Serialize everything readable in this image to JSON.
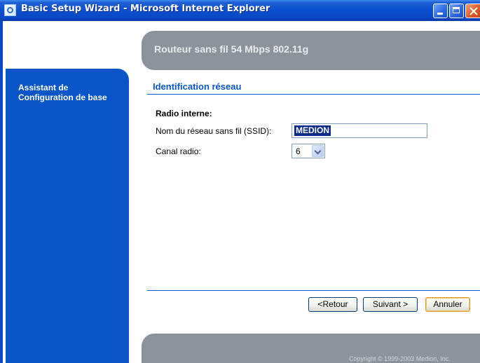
{
  "window": {
    "title": "Basic Setup Wizard - Microsoft Internet Explorer"
  },
  "header": {
    "title": "Routeur sans fil 54 Mbps 802.11g"
  },
  "sidebar": {
    "label": "Assistant de Configuration de base"
  },
  "section": {
    "title": "Identification réseau",
    "subsection": "Radio interne:"
  },
  "form": {
    "ssid_label": "Nom du réseau sans fil (SSID):",
    "ssid_value": "MEDION",
    "channel_label": "Canal radio:",
    "channel_value": "6"
  },
  "buttons": {
    "back": "<Retour",
    "next": "Suivant >",
    "cancel": "Annuler"
  },
  "footer": {
    "copyright": "Copyright © 1999-2003 Medion, Inc."
  },
  "colors": {
    "accent_blue": "#0a56c8",
    "header_gray": "#8c939d",
    "titlebar_blue": "#0a4fd0"
  }
}
